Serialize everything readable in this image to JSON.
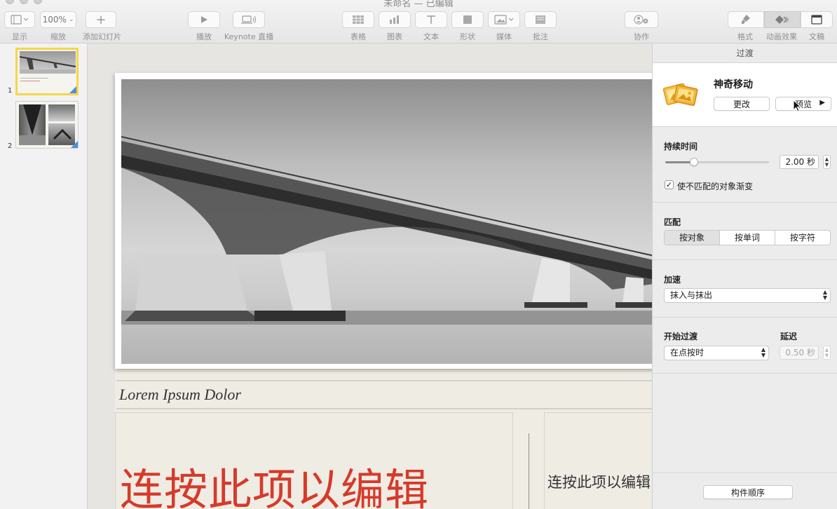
{
  "window": {
    "title": "未命名 — 已编辑"
  },
  "toolbar": {
    "view_label": "显示",
    "zoom_value": "100%",
    "zoom_label": "缩放",
    "add_slide_label": "添加幻灯片",
    "play_label": "播放",
    "keynote_live_label": "Keynote 直播",
    "table_label": "表格",
    "chart_label": "图表",
    "text_label": "文本",
    "shape_label": "形状",
    "media_label": "媒体",
    "comment_label": "批注",
    "collaborate_label": "协作",
    "format_label": "格式",
    "animate_label": "动画效果",
    "document_label": "文稿"
  },
  "navigator": {
    "slides": [
      {
        "number": "1"
      },
      {
        "number": "2"
      }
    ]
  },
  "slide": {
    "subtitle": "Lorem Ipsum Dolor",
    "big_text": "连按此项以编辑",
    "small_text": "连按此项以编辑"
  },
  "inspector": {
    "tab_title": "过渡",
    "transition_name": "神奇移动",
    "change_button": "更改",
    "preview_button": "预览",
    "duration_title": "持续时间",
    "duration_value": "2.00 秒",
    "duration_fraction": 0.28,
    "fade_checkbox_label": "使不匹配的对象渐变",
    "fade_checked": true,
    "match_title": "匹配",
    "match_options": [
      "按对象",
      "按单词",
      "按字符"
    ],
    "match_selected": 0,
    "acceleration_title": "加速",
    "acceleration_value": "抹入与抹出",
    "start_title": "开始过渡",
    "start_value": "在点按时",
    "delay_title": "延迟",
    "delay_value": "0.50 秒",
    "build_order_button": "构件顺序"
  },
  "colors": {
    "accent_selection": "#f5d74a",
    "title_red": "#d63a2a",
    "badge_blue": "#4a8fe2"
  }
}
